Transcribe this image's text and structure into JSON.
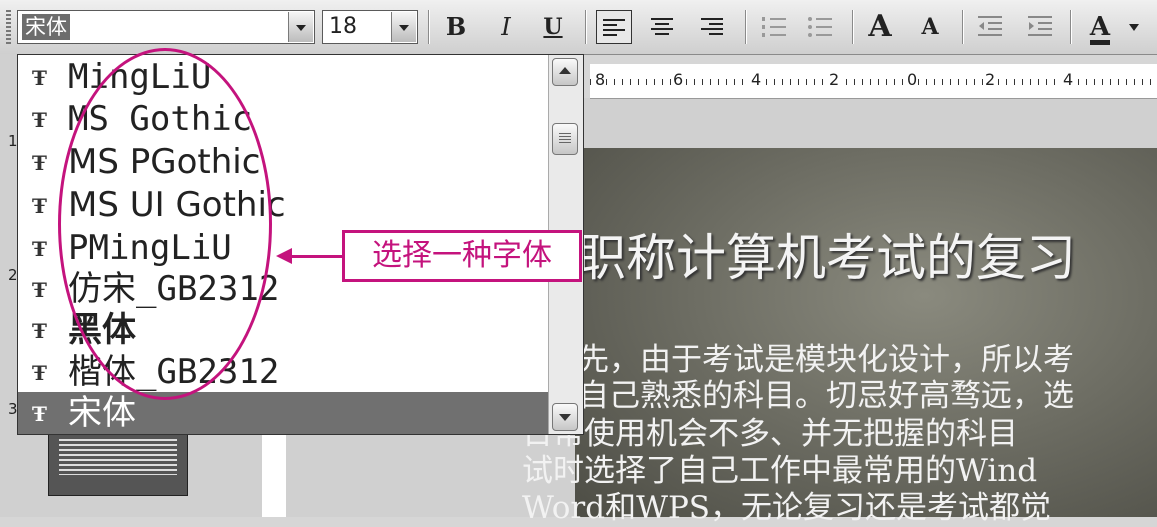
{
  "toolbar": {
    "font_value": "宋体",
    "size_value": "18",
    "bold_label": "B",
    "italic_label": "I",
    "underline_label": "U",
    "grow_font_label": "A",
    "shrink_font_label": "A",
    "font_color_label": "A"
  },
  "ruler": {
    "labels": [
      "8",
      "6",
      "4",
      "2",
      "0",
      "2",
      "4"
    ]
  },
  "side_numbers": [
    "1",
    "2",
    "3"
  ],
  "font_list": {
    "items": [
      {
        "label": "MingLiU",
        "selected": false
      },
      {
        "label": "MS Gothic",
        "selected": false
      },
      {
        "label": "MS PGothic",
        "selected": false
      },
      {
        "label": "MS UI Gothic",
        "selected": false
      },
      {
        "label": "PMingLiU",
        "selected": false
      },
      {
        "label": "仿宋_GB2312",
        "selected": false
      },
      {
        "label": "黑体",
        "selected": false
      },
      {
        "label": "楷体_GB2312",
        "selected": false
      },
      {
        "label": "宋体",
        "selected": true
      }
    ],
    "icon_glyph": "Ŧ"
  },
  "annotation": {
    "callout_text": "选择一种字体",
    "color": "#c4137d"
  },
  "slide": {
    "title": "职称计算机考试的复习",
    "body_lines": [
      "先，由于考试是模块化设计，所以考",
      "自己熟悉的科目。切忌好高骛远，选",
      "日常使用机会不多、并无把握的科目",
      "试时选择了自己工作中最常用的Wind",
      "Word和WPS，无论复习还是考试都觉"
    ]
  },
  "colors": {
    "selection": "#707070",
    "annotation": "#c4137d"
  }
}
